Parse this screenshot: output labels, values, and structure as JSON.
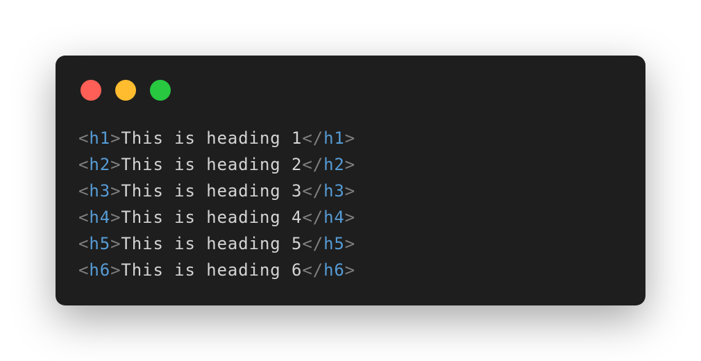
{
  "window_controls": {
    "close_color": "#ff5f57",
    "minimize_color": "#febc2e",
    "maximize_color": "#28c840"
  },
  "code_lines": [
    {
      "tag": "h1",
      "text": "This is heading 1"
    },
    {
      "tag": "h2",
      "text": "This is heading 2"
    },
    {
      "tag": "h3",
      "text": "This is heading 3"
    },
    {
      "tag": "h4",
      "text": "This is heading 4"
    },
    {
      "tag": "h5",
      "text": "This is heading 5"
    },
    {
      "tag": "h6",
      "text": "This is heading 6"
    }
  ],
  "syntax": {
    "open_lt": "<",
    "gt": ">",
    "close_lt": "</"
  }
}
